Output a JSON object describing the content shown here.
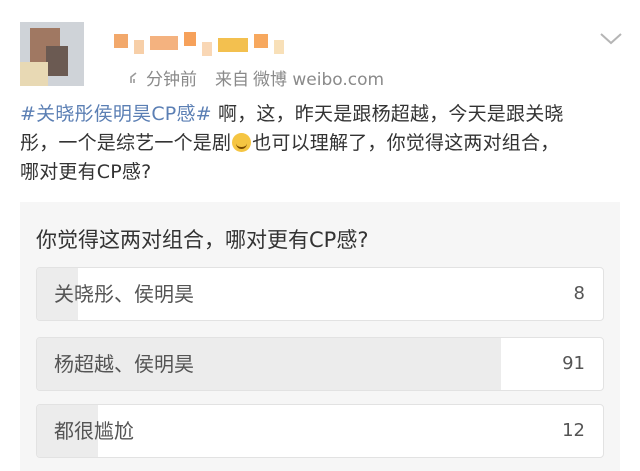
{
  "post": {
    "username_obscured": true,
    "time": "分钟前",
    "source_prefix": "来自",
    "source": "微博 weibo.com",
    "text": {
      "hashtag": "#关晓彤侯明昊CP感#",
      "line1_rest": " 啊，这，昨天是跟杨超越，今天是跟关晓",
      "line2_a": "彤，一个是综艺一个是剧",
      "emoji": "laughing-emoji-icon",
      "line2_b": "也可以理解了，你觉得这两对组合，",
      "line3": "哪对更有CP感?"
    }
  },
  "poll": {
    "question": "你觉得这两对组合，哪对更有CP感?",
    "options": [
      {
        "label": "关晓彤、侯明昊",
        "votes": "8",
        "share": 0.072
      },
      {
        "label": "杨超越、侯明昊",
        "votes": "91",
        "share": 0.82
      },
      {
        "label": "都很尴尬",
        "votes": "12",
        "share": 0.108
      }
    ]
  },
  "colors": {
    "hashtag": "#5b7fb4",
    "meta_text": "#8a8a8a",
    "poll_bg": "#f6f6f6",
    "bar_fill": "#ececec"
  }
}
